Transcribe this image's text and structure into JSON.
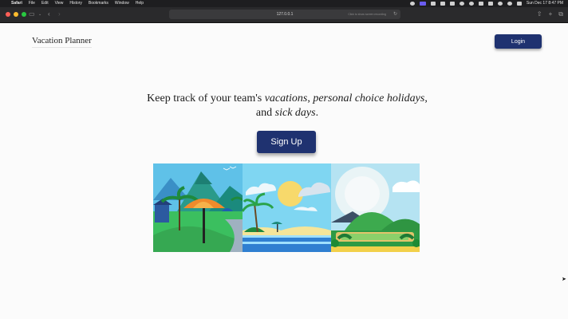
{
  "menubar": {
    "app": "Safari",
    "items": [
      "File",
      "Edit",
      "View",
      "History",
      "Bookmarks",
      "Window",
      "Help"
    ],
    "datetime": "Sun Dec 17  8:47 PM"
  },
  "browser": {
    "address": "127.0.0.1",
    "address_hint": "Click to show screen recording"
  },
  "page": {
    "brand": "Vacation Planner",
    "login_label": "Login",
    "tagline": {
      "t1": "Keep track of your team's ",
      "em1": "vacations",
      "t2": ", ",
      "em2": "personal choice holidays",
      "t3": ", and ",
      "em3": "sick days",
      "t4": "."
    },
    "signup_label": "Sign Up"
  },
  "colors": {
    "button": "#1f3270",
    "page_bg": "#fbfbfb"
  }
}
